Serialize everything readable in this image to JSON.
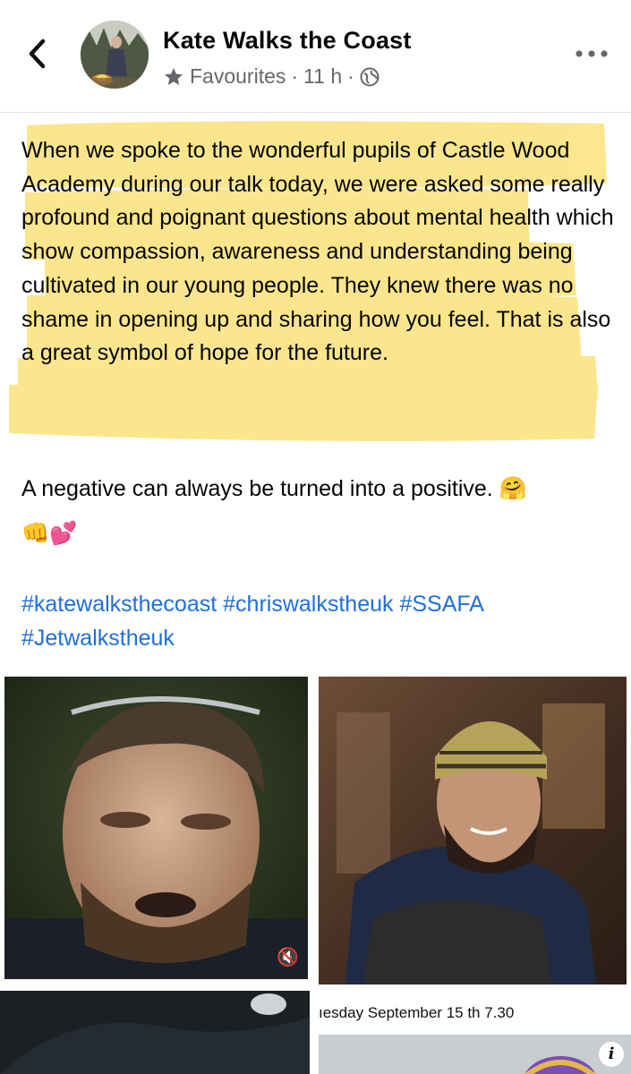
{
  "header": {
    "title": "Kate Walks the Coast",
    "audience": "Favourites",
    "separator": "·",
    "time": "11 h",
    "separator2": "·"
  },
  "post": {
    "paragraph": "When we spoke to the wonderful pupils of Castle Wood Academy during our talk today, we were asked some really profound and poignant questions about mental health which show compassion, awareness and understanding being cultivated in our young people. They knew there was no shame in opening up and sharing how you feel. That is also a great symbol of hope for the future.",
    "line2": "A negative can always be turned into a positive. 🤗",
    "emojis": "👊💕",
    "hashtags": [
      "#katewalksthecoast",
      "#chriswalkstheuk",
      "#SSAFA",
      "#Jetwalkstheuk"
    ],
    "highlight_color": "#fbe27a"
  },
  "photos": {
    "p4_caption": "ıesday September 15 th 7.30",
    "mute_icon": "🔇",
    "info_icon": "i"
  },
  "colors": {
    "link": "#216fdb",
    "meta": "#65676b"
  }
}
